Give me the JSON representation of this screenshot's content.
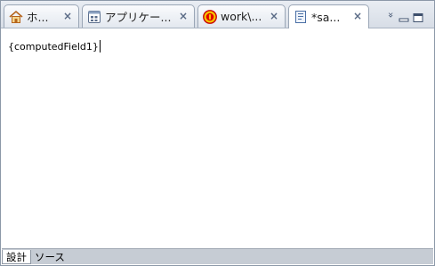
{
  "tabs": [
    {
      "label": "ホ...",
      "icon": "home-icon",
      "active": false
    },
    {
      "label": "アプリケー...",
      "icon": "application-icon",
      "active": false
    },
    {
      "label": "work\\...",
      "icon": "sii-logo-icon",
      "active": false
    },
    {
      "label": "*sa...",
      "icon": "form-document-icon",
      "active": true
    }
  ],
  "close_glyph": "×",
  "view_controls": {
    "overflow": "»",
    "minimize": "minimize",
    "maximize": "maximize"
  },
  "editor": {
    "field_text": "{computedField1}"
  },
  "bottom_tabs": [
    {
      "label": "設計",
      "active": true
    },
    {
      "label": "ソース",
      "active": false
    }
  ],
  "colors": {
    "accent": "#5a6b86",
    "tab_border": "#9aa6b6",
    "bottom_bar": "#c6ccd4"
  }
}
